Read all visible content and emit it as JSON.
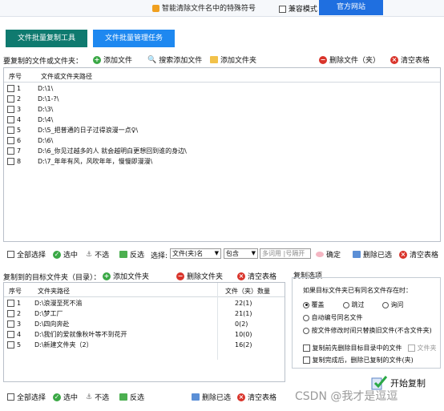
{
  "app": {
    "title": "智能清除文件名中的特殊符号",
    "compat_mode": "兼容模式",
    "official_site": "官方网站"
  },
  "tabs": [
    {
      "label": "文件批量复制工具",
      "color": "#0f7a6f"
    },
    {
      "label": "文件批量管理任务",
      "color": "#1e88f0"
    }
  ],
  "source": {
    "label": "要复制的文件或文件夹：",
    "add_file": "添加文件",
    "search_add_file": "搜索添加文件",
    "add_folder": "添加文件夹",
    "delete": "删除文件（夹）",
    "clear": "清空表格",
    "col_no": "序号",
    "col_path": "文件或文件夹路径",
    "rows": [
      {
        "no": "1",
        "path": "D:\\1\\"
      },
      {
        "no": "2",
        "path": "D:\\1-?\\"
      },
      {
        "no": "3",
        "path": "D:\\3\\"
      },
      {
        "no": "4",
        "path": "D:\\4\\"
      },
      {
        "no": "5",
        "path": "D:\\5_把普通的日子过得浪漫一点♀\\"
      },
      {
        "no": "6",
        "path": "D:\\6\\"
      },
      {
        "no": "7",
        "path": "D:\\6_你见过越多的人 就会越明白更想回到谁的身边\\"
      },
      {
        "no": "8",
        "path": "D:\\7_年年有风，风吹年年，慢慢即漫漫\\"
      }
    ]
  },
  "filter_bar": {
    "select_all": "全部选择",
    "select": "选中",
    "unselect": "不选",
    "invert": "反选",
    "choose": "选择:",
    "field": "文件(夹)名",
    "op": "包含",
    "placeholder": "多词用 |号隔开",
    "confirm": "确定",
    "delete_selected": "删除已选",
    "clear": "清空表格"
  },
  "target": {
    "label": "复制到的目标文件夹（目录）：",
    "add_folder": "添加文件夹",
    "delete_folder": "删除文件夹",
    "clear": "清空表格",
    "col_no": "序号",
    "col_path": "文件夹路径",
    "col_count": "文件（夹）数量",
    "rows": [
      {
        "no": "1",
        "path": "D:\\浪漫至死不渝",
        "count": "22(1)"
      },
      {
        "no": "2",
        "path": "D:\\梦工厂",
        "count": "21(1)"
      },
      {
        "no": "3",
        "path": "D:\\四向奔赴",
        "count": "0(2)"
      },
      {
        "no": "4",
        "path": "D:\\我们的爱就像秋叶等不到花开",
        "count": "10(0)"
      },
      {
        "no": "5",
        "path": "D:\\新建文件夹（2）",
        "count": "16(2)"
      }
    ]
  },
  "bottom_bar": {
    "select_all": "全部选择",
    "select": "选中",
    "unselect": "不选",
    "invert": "反选",
    "delete_selected": "删除已选",
    "clear": "清空表格"
  },
  "options": {
    "title": "复制选项",
    "same_name_label": "如果目标文件夹已有同名文件存在时：",
    "overwrite": "覆盖",
    "skip": "跳过",
    "ask": "询问",
    "auto_number": "自动编号同名文件",
    "replace_by_time": "按文件修改时间只替换旧文件(不含文件夹)",
    "delete_before_copy": "复制前先删除目标目录中的文件",
    "folder": "文件夹",
    "delete_after_copy": "复制完成后，删除已复制的文件(夹)",
    "start_copy": "开始复制"
  },
  "watermark": "CSDN @我才是逗逗"
}
